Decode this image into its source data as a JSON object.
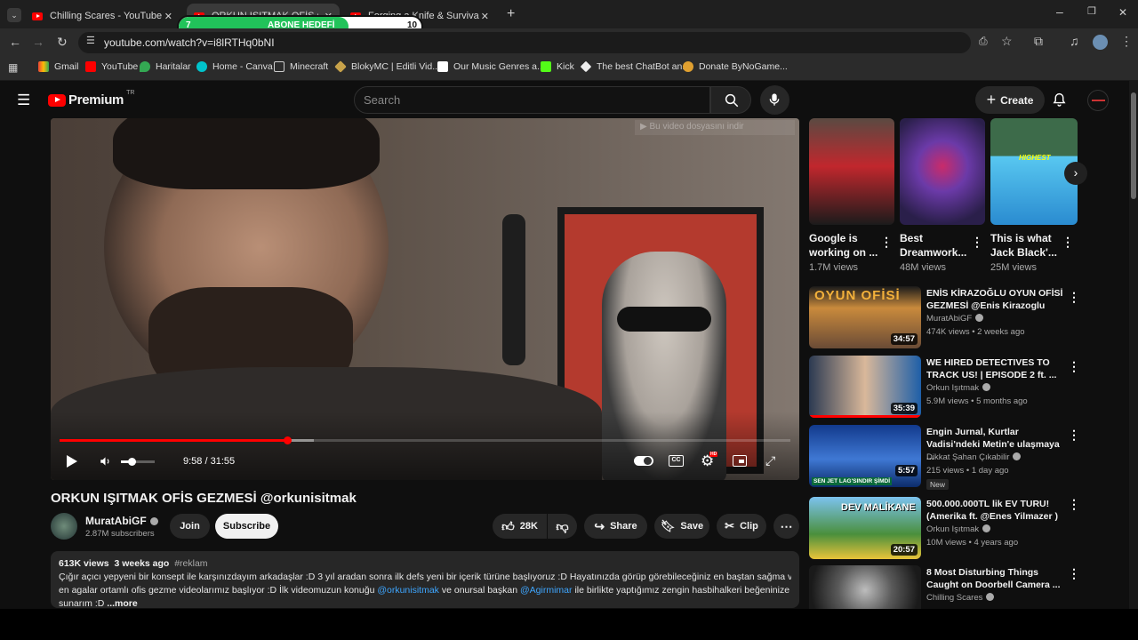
{
  "browser": {
    "tabs": [
      {
        "title": "Chilling Scares - YouTube"
      },
      {
        "title": "ORKUN IŞITMAK OFİS GEZMESİ"
      },
      {
        "title": "Forging a Knife & Survival Camp"
      }
    ],
    "overlay": {
      "left_num": "7",
      "label": "ABONE HEDEFİ",
      "right_num": "10",
      "progress": 0.7
    },
    "url": "youtube.com/watch?v=i8lRTHq0bNI",
    "bookmarks": [
      "Gmail",
      "YouTube",
      "Haritalar",
      "Home - Canva",
      "Minecraft",
      "BlokyMC | Editli Vid...",
      "Our Music Genres a...",
      "Kick",
      "The best ChatBot an...",
      "Donate ByNoGame..."
    ]
  },
  "youtube": {
    "logo": "Premium",
    "country": "TR",
    "search_placeholder": "Search",
    "create_label": "Create",
    "player": {
      "current_time": "9:58",
      "duration": "31:55",
      "progress": 0.312,
      "buffered": 0.348,
      "overlay_text": "Bu video dosyasını indir"
    },
    "video": {
      "title": "ORKUN IŞITMAK OFİS GEZMESİ @orkunisitmak",
      "channel": "MuratAbiGF",
      "subscribers": "2.87M subscribers",
      "join": "Join",
      "subscribe": "Subscribe",
      "likes": "28K",
      "share": "Share",
      "save": "Save",
      "clip": "Clip",
      "views": "613K views",
      "age": "3 weeks ago",
      "tag": "#reklam",
      "desc_1": "Çığır açıcı yepyeni bir konsept ile karşınızdayım arkadaşlar :D 3 yıl aradan sonra ilk defs yeni bir içerik türüne başlıyoruz :D Hayatınızda görüp görebileceğiniz en baştan sağma ve",
      "desc_2_a": "en agalar ortamlı ofis gezme videolarımız başlıyor :D İlk videomuzun konuğu",
      "mention_1": "@orkunisitmak",
      "desc_2_b": "ve onursal başkan",
      "mention_2": "@Agirmimar",
      "desc_2_c": "ile birlikte yaptığımız zengin hasbihalkeri beğeninize",
      "desc_3": "sunarım :D",
      "more": "...more"
    },
    "shorts": [
      {
        "title": "Google is working on ...",
        "views": "1.7M views"
      },
      {
        "title": "Best Dreamwork...",
        "views": "48M views"
      },
      {
        "title": "This is what Jack Black'...",
        "views": "25M views"
      }
    ],
    "recommendations": [
      {
        "title": "ENİS KİRAZOĞLU OYUN OFİSİ GEZMESİ @Enis Kirazoglu",
        "channel": "MuratAbiGF",
        "meta": "474K views • 2 weeks ago",
        "duration": "34:57",
        "thumb_text": "OYUN OFİSİ",
        "badge": ""
      },
      {
        "title": "WE HIRED DETECTIVES TO TRACK US! | EPISODE 2 ft. ...",
        "channel": "Orkun Işıtmak",
        "meta": "5.9M views • 5 months ago",
        "duration": "35:39",
        "thumb_text": "",
        "badge": ""
      },
      {
        "title": "Engin Jurnal, Kurtlar Vadisi'ndeki Metin'e ulaşmaya ...",
        "channel": "Dikkat Şahan Çıkabilir",
        "meta": "215 views • 1 day ago",
        "duration": "5:57",
        "thumb_text": "SEN JET LAG'SINDIR ŞİMDİ",
        "badge": "New"
      },
      {
        "title": "500.000.000TL lik EV TURU! (Amerika ft. @Enes Yilmazer )",
        "channel": "Orkun Işıtmak",
        "meta": "10M views • 4 years ago",
        "duration": "20:57",
        "thumb_text": "DEV MALİKANE",
        "badge": ""
      },
      {
        "title": "8 Most Disturbing Things Caught on Doorbell Camera ...",
        "channel": "Chilling Scares",
        "meta": "",
        "duration": "",
        "thumb_text": "",
        "badge": ""
      }
    ]
  }
}
